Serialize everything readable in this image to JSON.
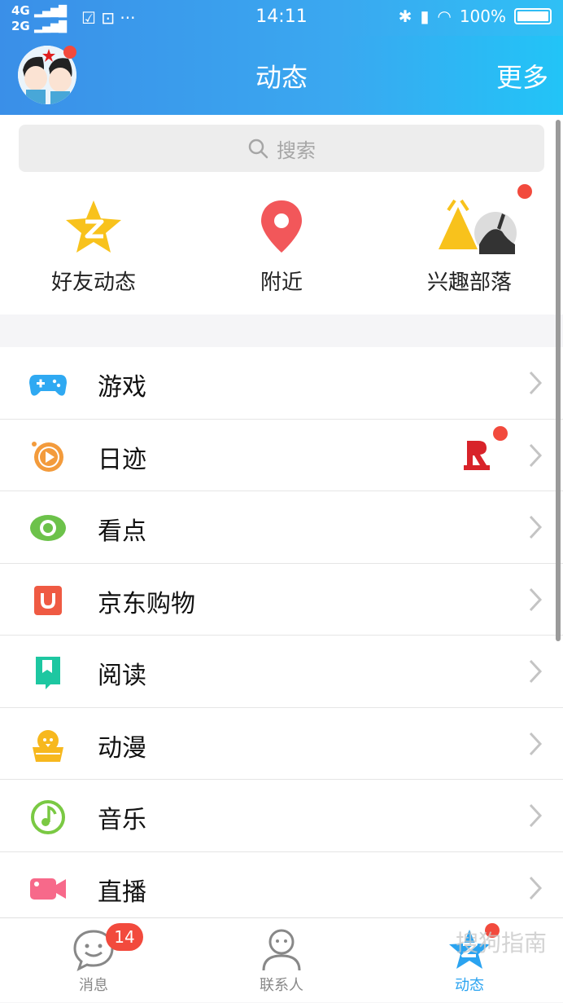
{
  "status_bar": {
    "network_top": "4G",
    "network_bottom": "2G",
    "time": "14:11",
    "battery": "100%"
  },
  "header": {
    "title": "动态",
    "more_label": "更多"
  },
  "search": {
    "placeholder": "搜索"
  },
  "quick_entries": [
    {
      "label": "好友动态",
      "icon": "star-z-icon"
    },
    {
      "label": "附近",
      "icon": "location-pin-icon"
    },
    {
      "label": "兴趣部落",
      "icon": "tent-icon"
    }
  ],
  "menu_items": [
    {
      "label": "游戏",
      "icon": "gamepad-icon",
      "color": "#2fa9f2"
    },
    {
      "label": "日迹",
      "icon": "video-circle-icon",
      "color": "#f39b3c"
    },
    {
      "label": "看点",
      "icon": "eye-icon",
      "color": "#6cc24a"
    },
    {
      "label": "京东购物",
      "icon": "shopping-bag-icon",
      "color": "#ef5a43"
    },
    {
      "label": "阅读",
      "icon": "bookmark-book-icon",
      "color": "#1dc7a1"
    },
    {
      "label": "动漫",
      "icon": "chick-icon",
      "color": "#f7b81e"
    },
    {
      "label": "音乐",
      "icon": "music-note-icon",
      "color": "#7ac943"
    },
    {
      "label": "直播",
      "icon": "video-camera-icon",
      "color": "#f7698a"
    }
  ],
  "tab_bar": {
    "tabs": [
      {
        "label": "消息",
        "badge": "14"
      },
      {
        "label": "联系人"
      },
      {
        "label": "动态"
      }
    ],
    "active_color": "#2aa3f0"
  },
  "watermark": "搜狗指南"
}
